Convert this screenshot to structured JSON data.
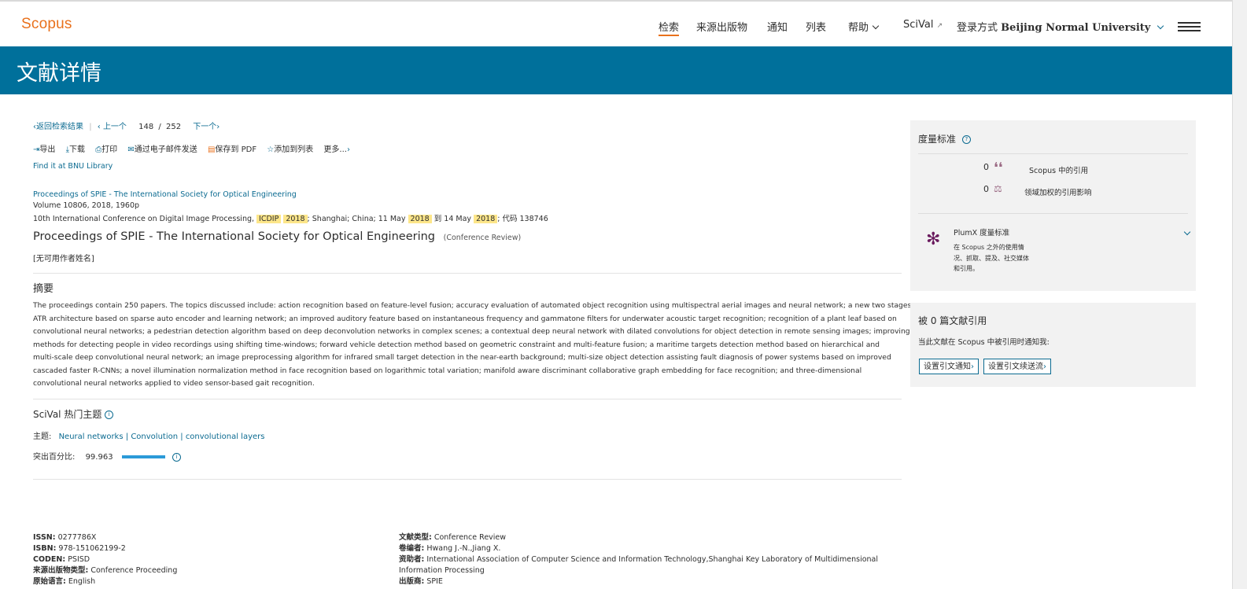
{
  "header": {
    "logo": "Scopus",
    "nav": {
      "search": "检索",
      "sources": "来源出版物",
      "alerts": "通知",
      "lists": "列表",
      "help": "帮助",
      "scival": "SciVal",
      "scival_arrow": "↗",
      "login_prefix": "登录方式",
      "login_institution": "Beijing Normal University"
    },
    "accent_color": "#e9711c"
  },
  "banner": {
    "title": "文献详情",
    "color": "#00709b"
  },
  "navigation": {
    "back_to_results": "返回检索结果",
    "prev": "上一个",
    "position": "148",
    "slash": "/",
    "total": "252",
    "next": "下一个"
  },
  "toolbar": {
    "export": "导出",
    "download": "下载",
    "print": "打印",
    "email": "通过电子邮件发送",
    "save_pdf": "保存到 PDF",
    "add_to_list": "添加到列表",
    "more": "更多..."
  },
  "find_it": "Find it at BNU Library",
  "document": {
    "source_link": "Proceedings of SPIE - The International Society for Optical Engineering",
    "volume": "Volume 10806, 2018, 1960p",
    "conference": {
      "part1": "10th International Conference on Digital Image Processing,",
      "icdip": "ICDIP",
      "year1": "2018",
      "part2": "; Shanghai; China; 11 May",
      "year2": "2018",
      "part3": "到 14 May",
      "year3": "2018",
      "part4": "; 代码 138746"
    },
    "title": "Proceedings of SPIE - The International Society for Optical Engineering",
    "type_badge": "(Conference Review)",
    "authors": "[无可用作者姓名]"
  },
  "abstract": {
    "heading": "摘要",
    "lines": [
      "The proceedings contain 250 papers. The topics discussed include: action recognition based on feature-level fusion; accuracy evaluation of automated object recognition using multispectral aerial images and neural network; a new two stages",
      "ATR architecture based on sparse auto encoder and learning network; an improved auditory feature based on instantaneous frequency and gammatone filters for underwater acoustic target recognition; recognition of a plant leaf based on",
      "convolutional neural networks; a pedestrian detection algorithm based on deep deconvolution networks in complex scenes; a contextual deep neural network with dilated convolutions for object detection in remote sensing images; improving",
      "methods for detecting people in video recordings using shifting time-windows; forward vehicle detection method based on geometric constraint and multi-feature fusion; a maritime targets detection method based on hierarchical and",
      "multi-scale deep convolutional neural network; an image preprocessing algorithm for infrared small target detection in the near-earth background; multi-size object detection assisting fault diagnosis of power systems based on improved",
      "cascaded faster R-CNNs; a novel illumination normalization method in face recognition based on logarithmic total variation; manifold aware discriminant collaborative graph embedding for face recognition; and three-dimensional",
      "convolutional neural networks applied to video sensor-based gait recognition."
    ]
  },
  "scival": {
    "heading": "SciVal 热门主题",
    "topic_label": "主题:",
    "topics": [
      "Neural networks",
      "Convolution",
      "convolutional layers"
    ],
    "separator": "|",
    "prominence_label": "突出百分比:",
    "prominence_value": "99.963",
    "prominence_fraction": 0.99963
  },
  "details_left": [
    {
      "label": "ISSN:",
      "value": "0277786X"
    },
    {
      "label": "ISBN:",
      "value": "978-151062199-2"
    },
    {
      "label": "CODEN:",
      "value": "PSISD"
    },
    {
      "label": "来源出版物类型:",
      "value": "Conference Proceeding"
    },
    {
      "label": "原始语言:",
      "value": "English"
    }
  ],
  "details_right": {
    "doc_type_label": "文献类型:",
    "doc_type": "Conference Review",
    "editors_label": "卷编者:",
    "editors": "Hwang J.-N.,Jiang X.",
    "sponsors_label": "资助者:",
    "sponsors_line1": "International Association of Computer Science and Information Technology,Shanghai Key Laboratory of Multidimensional",
    "sponsors_line2": "Information Processing",
    "publisher_label": "出版商:",
    "publisher": "SPIE"
  },
  "metrics": {
    "heading": "度量标准",
    "citations_count": "0",
    "citations_label": "Scopus 中的引用",
    "fwci_count": "0",
    "fwci_label": "领域加权的引用影响",
    "plumx_title": "PlumX 度量标准",
    "plumx_desc_lines": [
      "在 Scopus 之外的使用情",
      "况、抓取、提及、社交媒体",
      "和引用。"
    ]
  },
  "cited_by": {
    "heading": "被 0 篇文献引用",
    "notify_text": "当此文献在 Scopus 中被引用时通知我:",
    "alert_button": "设置引文通知",
    "feed_button": "设置引文续送流"
  }
}
